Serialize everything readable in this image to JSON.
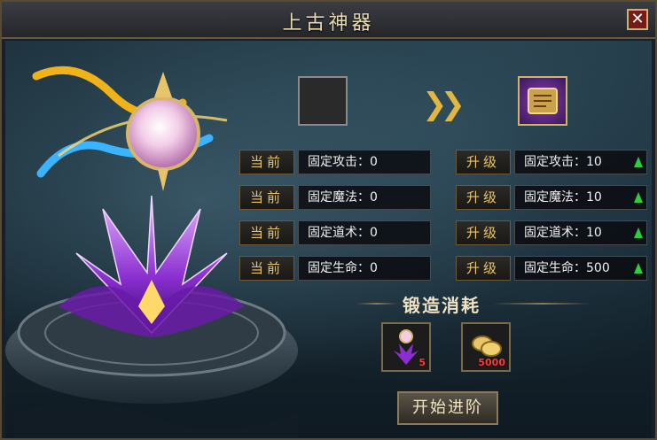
{
  "window": {
    "title": "上古神器"
  },
  "forge": {
    "current_label": "当前",
    "upgrade_label": "升级",
    "current_stats": [
      {
        "name": "固定攻击",
        "value": "0"
      },
      {
        "name": "固定魔法",
        "value": "0"
      },
      {
        "name": "固定道术",
        "value": "0"
      },
      {
        "name": "固定生命",
        "value": "0"
      }
    ],
    "upgraded_stats": [
      {
        "name": "固定攻击",
        "value": "10"
      },
      {
        "name": "固定魔法",
        "value": "10"
      },
      {
        "name": "固定道术",
        "value": "10"
      },
      {
        "name": "固定生命",
        "value": "500"
      }
    ]
  },
  "cost": {
    "title": "锻造消耗",
    "items": [
      {
        "icon": "artifact-material-icon",
        "quantity": "5"
      },
      {
        "icon": "gold-icon",
        "quantity": "5000"
      }
    ]
  },
  "actions": {
    "start_label": "开始进阶"
  },
  "icons": {
    "close": "close-icon",
    "arrow": "double-chevron-right-icon",
    "up": "arrow-up-icon"
  },
  "colors": {
    "accent": "#e7c46a",
    "increase": "#2ccf3a",
    "cost_qty": "#ff3a3a",
    "close_bg": "#7a1a16"
  }
}
